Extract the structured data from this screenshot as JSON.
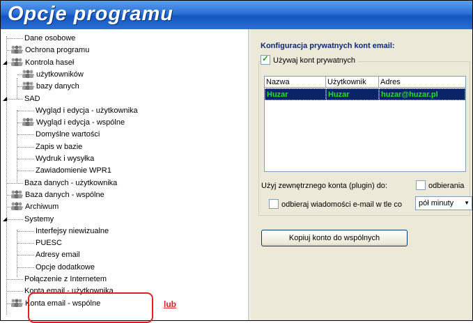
{
  "window": {
    "title": "Opcje programu"
  },
  "tree": [
    {
      "id": "dane-osobowe",
      "label": "Dane osobowe",
      "icon": false,
      "level": 1
    },
    {
      "id": "ochrona-programu",
      "label": "Ochrona programu",
      "icon": true,
      "level": 1
    },
    {
      "id": "kontrola-hasel",
      "label": "Kontrola haseł",
      "icon": true,
      "level": 1,
      "expanded": true
    },
    {
      "id": "uzytkownikow",
      "label": "użytkowników",
      "icon": true,
      "level": 2
    },
    {
      "id": "bazy-danych",
      "label": "bazy danych",
      "icon": true,
      "level": 2
    },
    {
      "id": "sad",
      "label": "SAD",
      "icon": false,
      "level": 1,
      "expanded": true
    },
    {
      "id": "wyglad-uzytkownika",
      "label": "Wygląd i edycja - użytkownika",
      "icon": false,
      "level": 2
    },
    {
      "id": "wyglad-wspolne",
      "label": "Wygląd i edycja - wspólne",
      "icon": true,
      "level": 2
    },
    {
      "id": "domyslne",
      "label": "Domyślne wartości",
      "icon": false,
      "level": 2
    },
    {
      "id": "zapis",
      "label": "Zapis w bazie",
      "icon": false,
      "level": 2
    },
    {
      "id": "wydruk",
      "label": "Wydruk i wysyłka",
      "icon": false,
      "level": 2
    },
    {
      "id": "zawiadomienie",
      "label": "Zawiadomienie WPR1",
      "icon": false,
      "level": 2
    },
    {
      "id": "baza-uzytkownika",
      "label": "Baza danych - użytkownika",
      "icon": false,
      "level": 1
    },
    {
      "id": "baza-wspolne",
      "label": "Baza danych - wspólne",
      "icon": true,
      "level": 1
    },
    {
      "id": "archiwum",
      "label": "Archiwum",
      "icon": true,
      "level": 1
    },
    {
      "id": "systemy",
      "label": "Systemy",
      "icon": false,
      "level": 1,
      "expanded": true
    },
    {
      "id": "interfejsy",
      "label": "Interfejsy niewizualne",
      "icon": false,
      "level": 2
    },
    {
      "id": "puesc",
      "label": "PUESC",
      "icon": false,
      "level": 2
    },
    {
      "id": "adresy",
      "label": "Adresy email",
      "icon": false,
      "level": 2
    },
    {
      "id": "opcje-dodatkowe",
      "label": "Opcje dodatkowe",
      "icon": false,
      "level": 2
    },
    {
      "id": "polaczenie",
      "label": "Połączenie z Internetem",
      "icon": false,
      "level": 1
    },
    {
      "id": "konta-uzytkownika",
      "label": "Konta email - użytkownika",
      "icon": false,
      "level": 1
    },
    {
      "id": "konta-wspolne",
      "label": "Konta email - wspólne",
      "icon": true,
      "level": 1
    }
  ],
  "config": {
    "title": "Konfiguracja prywatnych kont email:",
    "use_private_label": "Używaj kont prywatnych",
    "use_private_checked": true,
    "columns": [
      "Nazwa",
      "Użytkownik",
      "Adres"
    ],
    "rows": [
      {
        "nazwa": "Huzar",
        "uzytkownik": "Huzar",
        "adres": "huzar@huzar.pl"
      }
    ],
    "plugin_label": "Użyj zewnętrznego konta (plugin) do:",
    "odbierania_label": "odbierania",
    "background_label": "odbieraj wiadomości e-mail w tle co",
    "interval_value": "pół minuty",
    "copy_button": "Kopiuj konto do wspólnych"
  },
  "annotation": {
    "text": "lub",
    "color": "#e02020"
  },
  "colors": {
    "title_bar": "#2a6fd6",
    "selection": "#0a246a",
    "selection_text": "#23e023",
    "panel": "#ece9d8"
  }
}
